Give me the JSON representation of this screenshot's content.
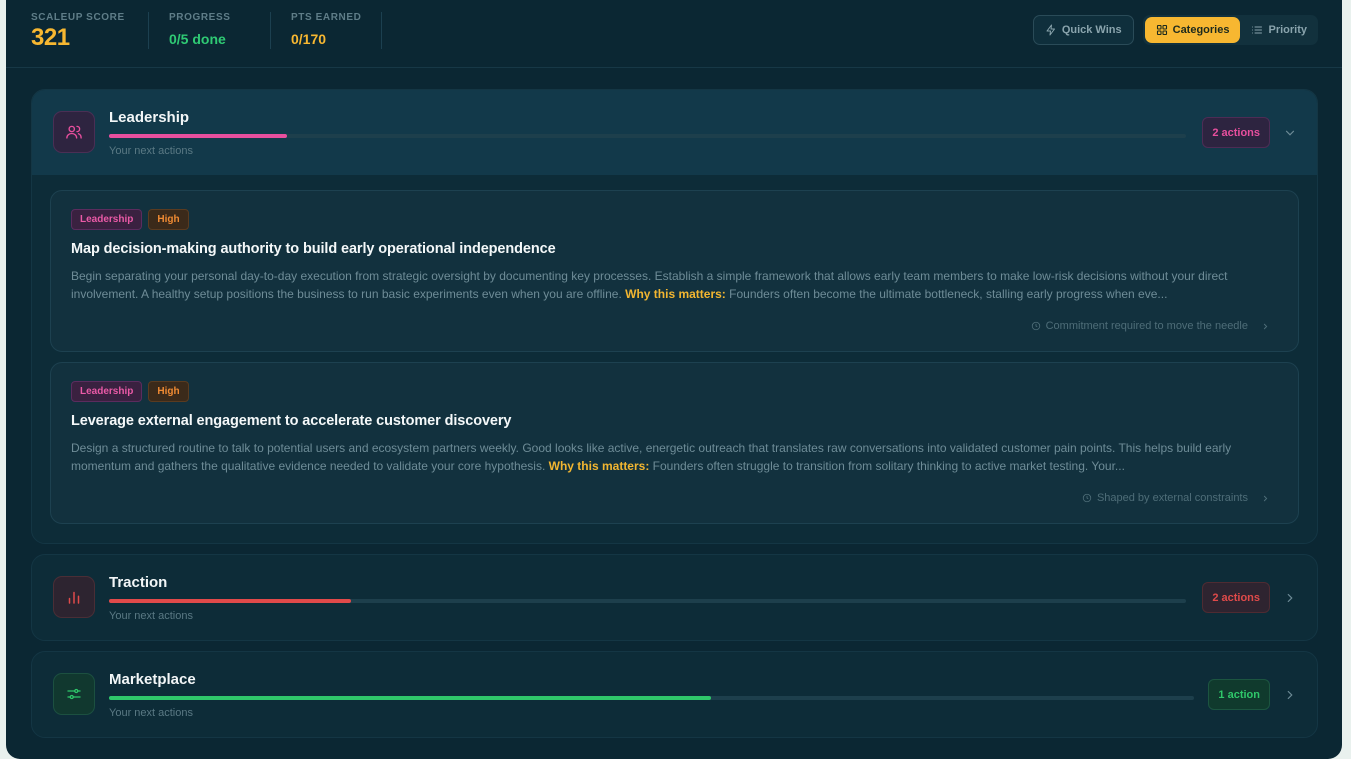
{
  "header": {
    "score_label": "SCALEUP SCORE",
    "score_value": "321",
    "progress_label": "PROGRESS",
    "progress_value": "0/5 done",
    "pts_label": "PTS EARNED",
    "pts_value": "0/170"
  },
  "toolbar": {
    "quick_wins": "Quick Wins",
    "categories": "Categories",
    "priority": "Priority"
  },
  "categories": [
    {
      "title": "Leadership",
      "subtitle": "Your next actions",
      "badge": "2 actions",
      "progress": 0.165,
      "color": "#e84f9e",
      "icon": "users-icon",
      "expanded": true,
      "actions": [
        {
          "tags": [
            "Leadership",
            "High"
          ],
          "title": "Map decision-making authority to build early operational independence",
          "desc": "Begin separating your personal day-to-day execution from strategic oversight by documenting key processes. Establish a simple framework that allows early team members to make low-risk decisions without your direct involvement. A healthy setup positions the business to run basic experiments even when you are offline.",
          "why_label": "Why this matters:",
          "why_text": "Founders often become the ultimate bottleneck, stalling early progress when eve...",
          "footer": "Commitment required to move the needle"
        },
        {
          "tags": [
            "Leadership",
            "High"
          ],
          "title": "Leverage external engagement to accelerate customer discovery",
          "desc": "Design a structured routine to talk to potential users and ecosystem partners weekly. Good looks like active, energetic outreach that translates raw conversations into validated customer pain points. This helps build early momentum and gathers the qualitative evidence needed to validate your core hypothesis.",
          "why_label": "Why this matters:",
          "why_text": "Founders often struggle to transition from solitary thinking to active market testing. Your...",
          "footer": "Shaped by external constraints"
        }
      ]
    },
    {
      "title": "Traction",
      "subtitle": "Your next actions",
      "badge": "2 actions",
      "progress": 0.225,
      "color": "#e04a4a",
      "icon": "bar-chart-icon",
      "expanded": false
    },
    {
      "title": "Marketplace",
      "subtitle": "Your next actions",
      "badge": "1 action",
      "progress": 0.555,
      "color": "#2fc76a",
      "icon": "sliders-icon",
      "expanded": false
    }
  ]
}
